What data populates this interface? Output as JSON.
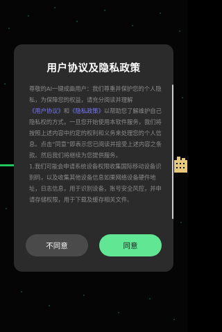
{
  "dialog": {
    "title": "用户协议及隐私政策",
    "body": {
      "intro": "尊敬的AI一键成曲用户：我们尊重并保护您的个人隐私，为保障您的权益，请充分阅读并理解",
      "link_user_agreement": "《用户协议》",
      "and": "和",
      "link_privacy_policy": "《隐私政策》",
      "middle": "以帮助您了解维护自己隐私权的方式，一旦您开始使用本软件服务，我们将按照上述内容中约定的权利和义务来处理您的个人信息。点击“同意”即表示您已阅读并接受上述内容之条款。然后我们将继续为您提供服务。",
      "clause_1": "1.我们可能会申请系统设备权限收集国际移动设备识别码，以及收集其他设备信息如果网络设备硬件地址，日志信息，用于识别设备，账号安全风控，并申请存储权限，用于下载及缓存相关文件。"
    },
    "buttons": {
      "disagree": "不同意",
      "agree": "同意"
    }
  },
  "colors": {
    "dialog_bg": "#2b2b2b",
    "agree_button": "#61e694",
    "disagree_button": "#4a4a4a",
    "link": "#7a78ff",
    "background_accent": "#22c55e"
  }
}
